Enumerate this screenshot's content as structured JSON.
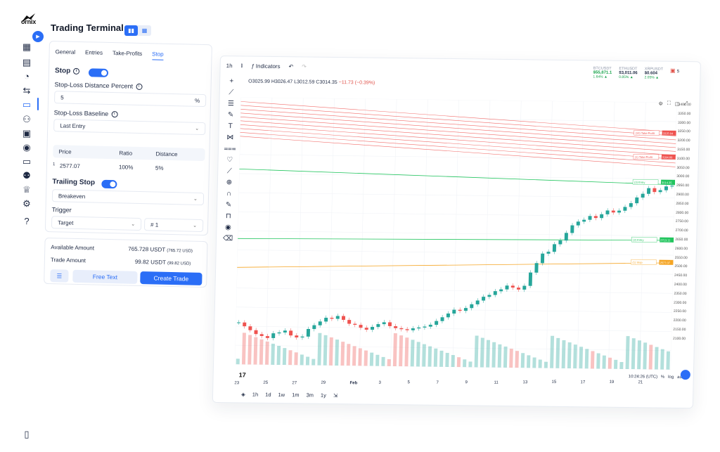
{
  "brand": {
    "logo_text": "ornix"
  },
  "header": {
    "title": "Trading Terminal"
  },
  "colors": {
    "accent": "#2b6ef6",
    "up": "#26a69a",
    "down": "#ef5350",
    "tp_line": "#ef5350",
    "entry_line": "#22c55e",
    "stop_line": "#f5a524"
  },
  "rail_icons": [
    "grid-icon",
    "table-icon",
    "pie-chart-icon",
    "swap-icon",
    "monitor-icon",
    "bot-icon",
    "robot-icon",
    "eye-icon",
    "card-icon",
    "users-icon",
    "crown-icon",
    "settings-icon",
    "help-icon"
  ],
  "tabs": [
    {
      "label": "General"
    },
    {
      "label": "Entries"
    },
    {
      "label": "Take-Profits"
    },
    {
      "label": "Stop"
    }
  ],
  "stop": {
    "section_label": "Stop",
    "distance_label": "Stop-Loss Distance Percent",
    "distance_value": "5",
    "distance_suffix": "%",
    "baseline_label": "Stop-Loss Baseline",
    "baseline_value": "Last Entry",
    "table": {
      "headers": [
        "Price",
        "Ratio",
        "Distance"
      ],
      "row": {
        "index": "1",
        "price": "2577.07",
        "ratio": "100%",
        "distance": "5%"
      }
    },
    "trailing_label": "Trailing Stop",
    "trailing_value": "Breakeven",
    "trigger_label": "Trigger",
    "trigger_value": "Target",
    "trigger_number": "# 1"
  },
  "summary": {
    "available_label": "Available Amount",
    "available_value": "765.728 USDT",
    "available_sub": "(765.72 USD)",
    "trade_label": "Trade Amount",
    "trade_value": "99.82 USDT",
    "trade_sub": "(99.82 USD)",
    "free_text_label": "Free Text",
    "create_trade_label": "Create Trade"
  },
  "chart_toolbar": {
    "interval": "1h",
    "indicators_label": "Indicators"
  },
  "ohlc": {
    "o": "O3025.99",
    "h": "H3026.47",
    "l": "L3012.59",
    "c": "C3014.35",
    "chg": "−11.73 (−0.39%)"
  },
  "tickers": [
    {
      "name": "BTCUSDT",
      "price": "$55,871.1",
      "change": "1.64% ▲"
    },
    {
      "name": "ETHUSDT",
      "price": "$3,011.06",
      "change": "0.85% ▲"
    },
    {
      "name": "XRPUSDT",
      "price": "$0.604",
      "change": "2.05% ▲"
    }
  ],
  "notif_count": "5",
  "chart_data": {
    "type": "line",
    "title": "",
    "xlabel": "",
    "ylabel": "",
    "ylim": [
      2050,
      3450
    ],
    "x_ticks": [
      "23",
      "25",
      "27",
      "29",
      "Feb",
      "3",
      "5",
      "7",
      "9",
      "11",
      "13",
      "15",
      "17",
      "19",
      "21"
    ],
    "y_ticks": [
      "3400.00",
      "3350.00",
      "3300.00",
      "3250.00",
      "3200.00",
      "3150.00",
      "3100.00",
      "3050.00",
      "3000.00",
      "2950.00",
      "2900.00",
      "2850.00",
      "2800.00",
      "2750.00",
      "2700.00",
      "2650.00",
      "2600.00",
      "2550.00",
      "2500.00",
      "2450.00",
      "2400.00",
      "2350.00",
      "2300.00",
      "2250.00",
      "2200.00",
      "2150.00",
      "2100.00"
    ],
    "series": [
      {
        "values": [
          2270,
          2250,
          2230,
          2210,
          2200,
          2190,
          2215,
          2220,
          2230,
          2205,
          2195,
          2200,
          2240,
          2260,
          2280,
          2300,
          2295,
          2310,
          2290,
          2270,
          2265,
          2250,
          2240,
          2255,
          2270,
          2280,
          2260,
          2250,
          2245,
          2240,
          2250,
          2255,
          2260,
          2270,
          2290,
          2310,
          2330,
          2350,
          2345,
          2360,
          2380,
          2400,
          2420,
          2430,
          2450,
          2460,
          2480,
          2470,
          2460,
          2480,
          2550,
          2600,
          2650,
          2660,
          2700,
          2720,
          2760,
          2800,
          2820,
          2830,
          2850,
          2840,
          2860,
          2880,
          2870,
          2880,
          2900,
          2920,
          2950,
          2970,
          3000,
          2980,
          2990,
          3010,
          3014
        ]
      }
    ],
    "level_labels": [
      {
        "label": "(10) Take-Profit",
        "price": "3315.64"
      },
      {
        "label": "(1) Take-Profit",
        "price": "3194.66"
      },
      {
        "label": "(3) Entry",
        "price": "3014.35"
      },
      {
        "label": "(2) Entry",
        "price": "2713.11"
      },
      {
        "label": "(1) Stop",
        "price": "2577.07"
      }
    ],
    "grid": true
  },
  "bottom_intervals": [
    "1h",
    "1d",
    "1w",
    "1m",
    "3m",
    "1y"
  ],
  "footer": {
    "time": "10:24:26 (UTC)",
    "pct": "%",
    "log": "log",
    "auto": "auto"
  }
}
